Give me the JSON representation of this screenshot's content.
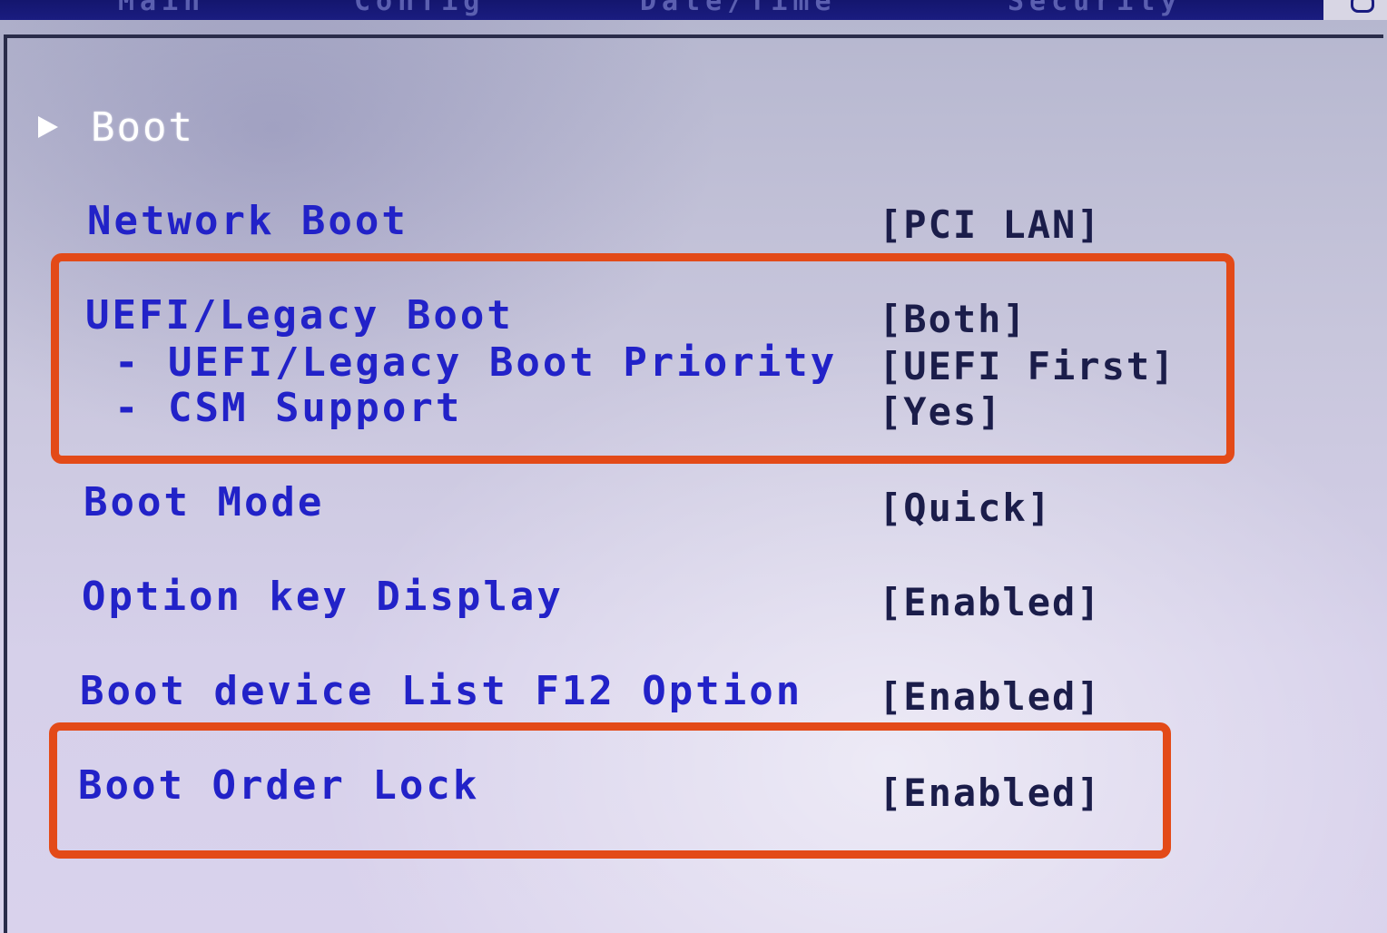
{
  "top_menu": {
    "tabs": [
      "Main",
      "Config",
      "Date/Time",
      "Security"
    ]
  },
  "section": {
    "title": "Boot"
  },
  "settings": [
    {
      "name": "Network Boot",
      "value": "[PCI LAN]"
    },
    {
      "name": "UEFI/Legacy Boot",
      "value": "[Both]"
    },
    {
      "name": "- UEFI/Legacy Boot Priority",
      "value": "[UEFI First]"
    },
    {
      "name": "- CSM Support",
      "value": "[Yes]"
    },
    {
      "name": "Boot Mode",
      "value": "[Quick]"
    },
    {
      "name": "Option key Display",
      "value": "[Enabled]"
    },
    {
      "name": "Boot device List F12 Option",
      "value": "[Enabled]"
    },
    {
      "name": "Boot Order Lock",
      "value": "[Enabled]"
    }
  ],
  "colors": {
    "item_text": "#2222c8",
    "value_text": "#1b1d4a",
    "highlight": "#e34a18"
  },
  "icons": {
    "section_arrow": "triangle-right-icon"
  }
}
